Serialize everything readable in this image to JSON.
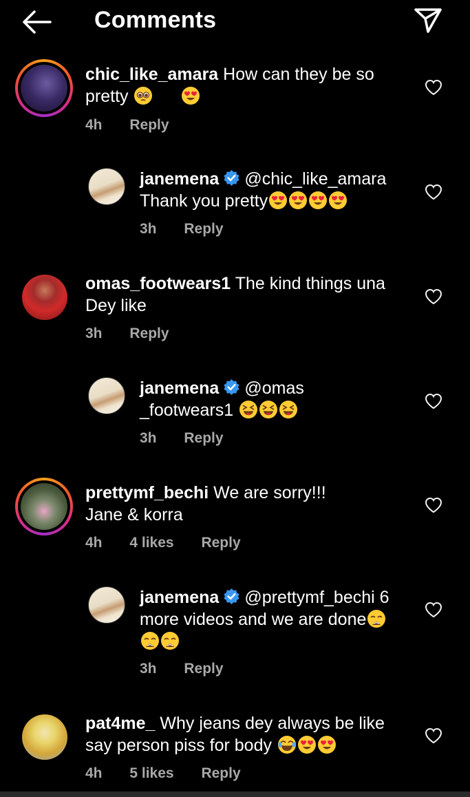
{
  "header": {
    "title": "Comments",
    "back_icon": "arrow-left-icon",
    "share_icon": "paper-plane-icon"
  },
  "comments": [
    {
      "username": "chic_like_amara",
      "text": "How can they be so",
      "text2": "pretty",
      "time": "4h",
      "likes": "",
      "reply": "Reply"
    },
    {
      "username": "janemena",
      "mention": "@chic_like_amara",
      "text2": "Thank you pretty",
      "time": "3h",
      "reply": "Reply"
    },
    {
      "username": "omas_footwears1",
      "text": "The kind things una",
      "text2": "Dey like",
      "time": "3h",
      "reply": "Reply"
    },
    {
      "username": "janemena",
      "mention": "@omas",
      "text2": "_footwears1",
      "time": "3h",
      "reply": "Reply"
    },
    {
      "username": "prettymf_bechi",
      "text": "We are sorry!!!",
      "text2": "Jane & korra",
      "time": "4h",
      "likes": "4 likes",
      "reply": "Reply"
    },
    {
      "username": "janemena",
      "mention": "@prettymf_bechi",
      "text": "6",
      "text2": "more videos and we are done",
      "time": "3h",
      "reply": "Reply"
    },
    {
      "username": "pat4me_",
      "text": "Why jeans dey always be like",
      "text2": "say person piss for body",
      "time": "4h",
      "likes": "5 likes",
      "reply": "Reply"
    }
  ],
  "colors": {
    "background": "#000000",
    "meta": "#a8a8a8",
    "verified": "#3897f0",
    "heart-eyes": "#ffcc33"
  }
}
